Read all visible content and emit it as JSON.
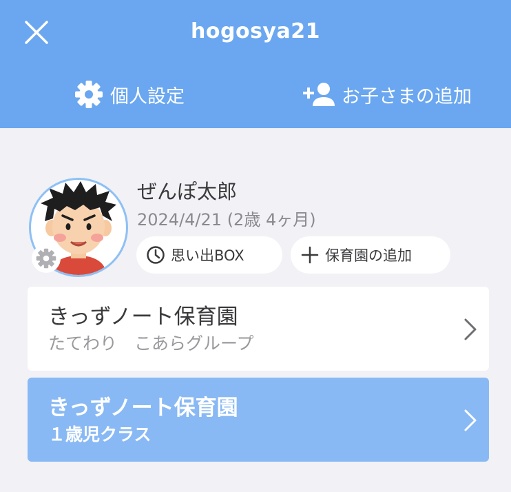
{
  "header": {
    "title": "hogosya21",
    "settings_label": "個人設定",
    "add_child_label": "お子さまの追加"
  },
  "child": {
    "name": "ぜんぽ太郎",
    "birth": "2024/4/21 (2歳 4ヶ月)",
    "memory_box_label": "思い出BOX",
    "add_nursery_label": "保育園の追加"
  },
  "nurseries": [
    {
      "name": "きっずノート保育園",
      "group": "たてわり　こあらグループ",
      "selected": false
    },
    {
      "name": "きっずノート保育園",
      "group": "１歳児クラス",
      "selected": true
    }
  ],
  "icons": {
    "close": "close-icon",
    "settings": "gear-icon",
    "add_child": "add-person-icon",
    "memory": "clock-icon",
    "add": "plus-icon",
    "chevron": "chevron-right-icon"
  },
  "colors": {
    "header_bg": "#6aa7f0",
    "selected_card_bg": "#89b9f4",
    "page_bg": "#f1f1f6"
  }
}
